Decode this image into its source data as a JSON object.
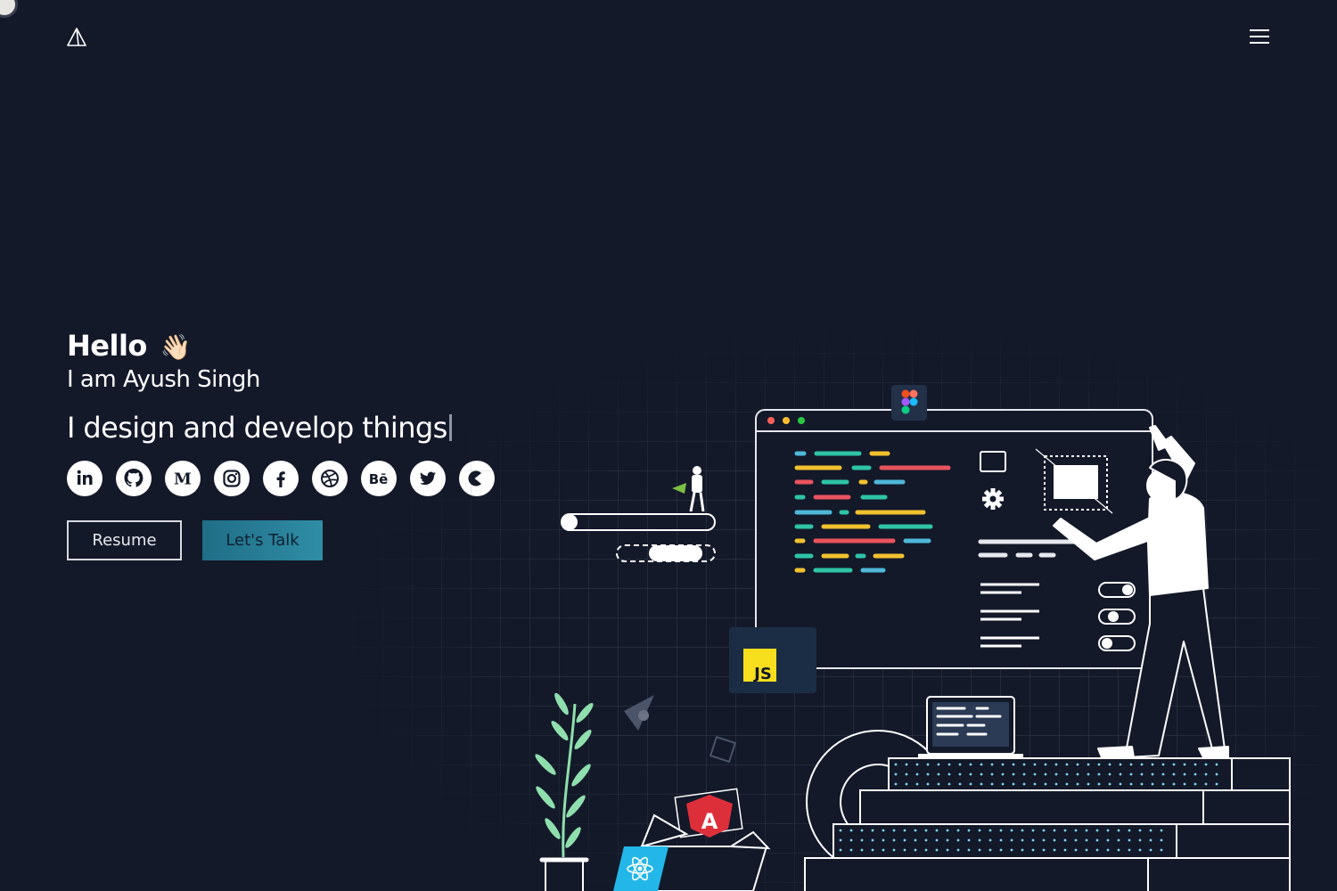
{
  "header": {
    "logo_icon": "triangle-logo-icon",
    "menu_icon": "hamburger-menu-icon"
  },
  "hero": {
    "greeting": "Hello",
    "wave_emoji": "👋🏻",
    "intro": "I am Ayush Singh",
    "tagline": "I design and develop things"
  },
  "socials": [
    {
      "name": "linkedin",
      "icon": "linkedin-icon"
    },
    {
      "name": "github",
      "icon": "github-icon"
    },
    {
      "name": "medium",
      "icon": "medium-icon"
    },
    {
      "name": "instagram",
      "icon": "instagram-icon"
    },
    {
      "name": "facebook",
      "icon": "facebook-icon"
    },
    {
      "name": "dribbble",
      "icon": "dribbble-icon"
    },
    {
      "name": "behance",
      "icon": "behance-icon"
    },
    {
      "name": "twitter",
      "icon": "twitter-icon"
    },
    {
      "name": "codepen-c",
      "icon": "c-logo-icon"
    }
  ],
  "buttons": {
    "resume": "Resume",
    "talk": "Let's Talk"
  },
  "illustration": {
    "js_badge": "JS",
    "colors": {
      "background": "#131929",
      "grid": "#3a4154",
      "accent": "#2f8da5",
      "code_green": "#2ec4a6",
      "code_yellow": "#f2c12e",
      "code_red": "#e9535d",
      "code_blue": "#4fb8d9",
      "js_yellow": "#f7df1e",
      "angular_red": "#dd2f3a",
      "react_cyan": "#22b7e8",
      "plant_green": "#8fdfae"
    }
  }
}
